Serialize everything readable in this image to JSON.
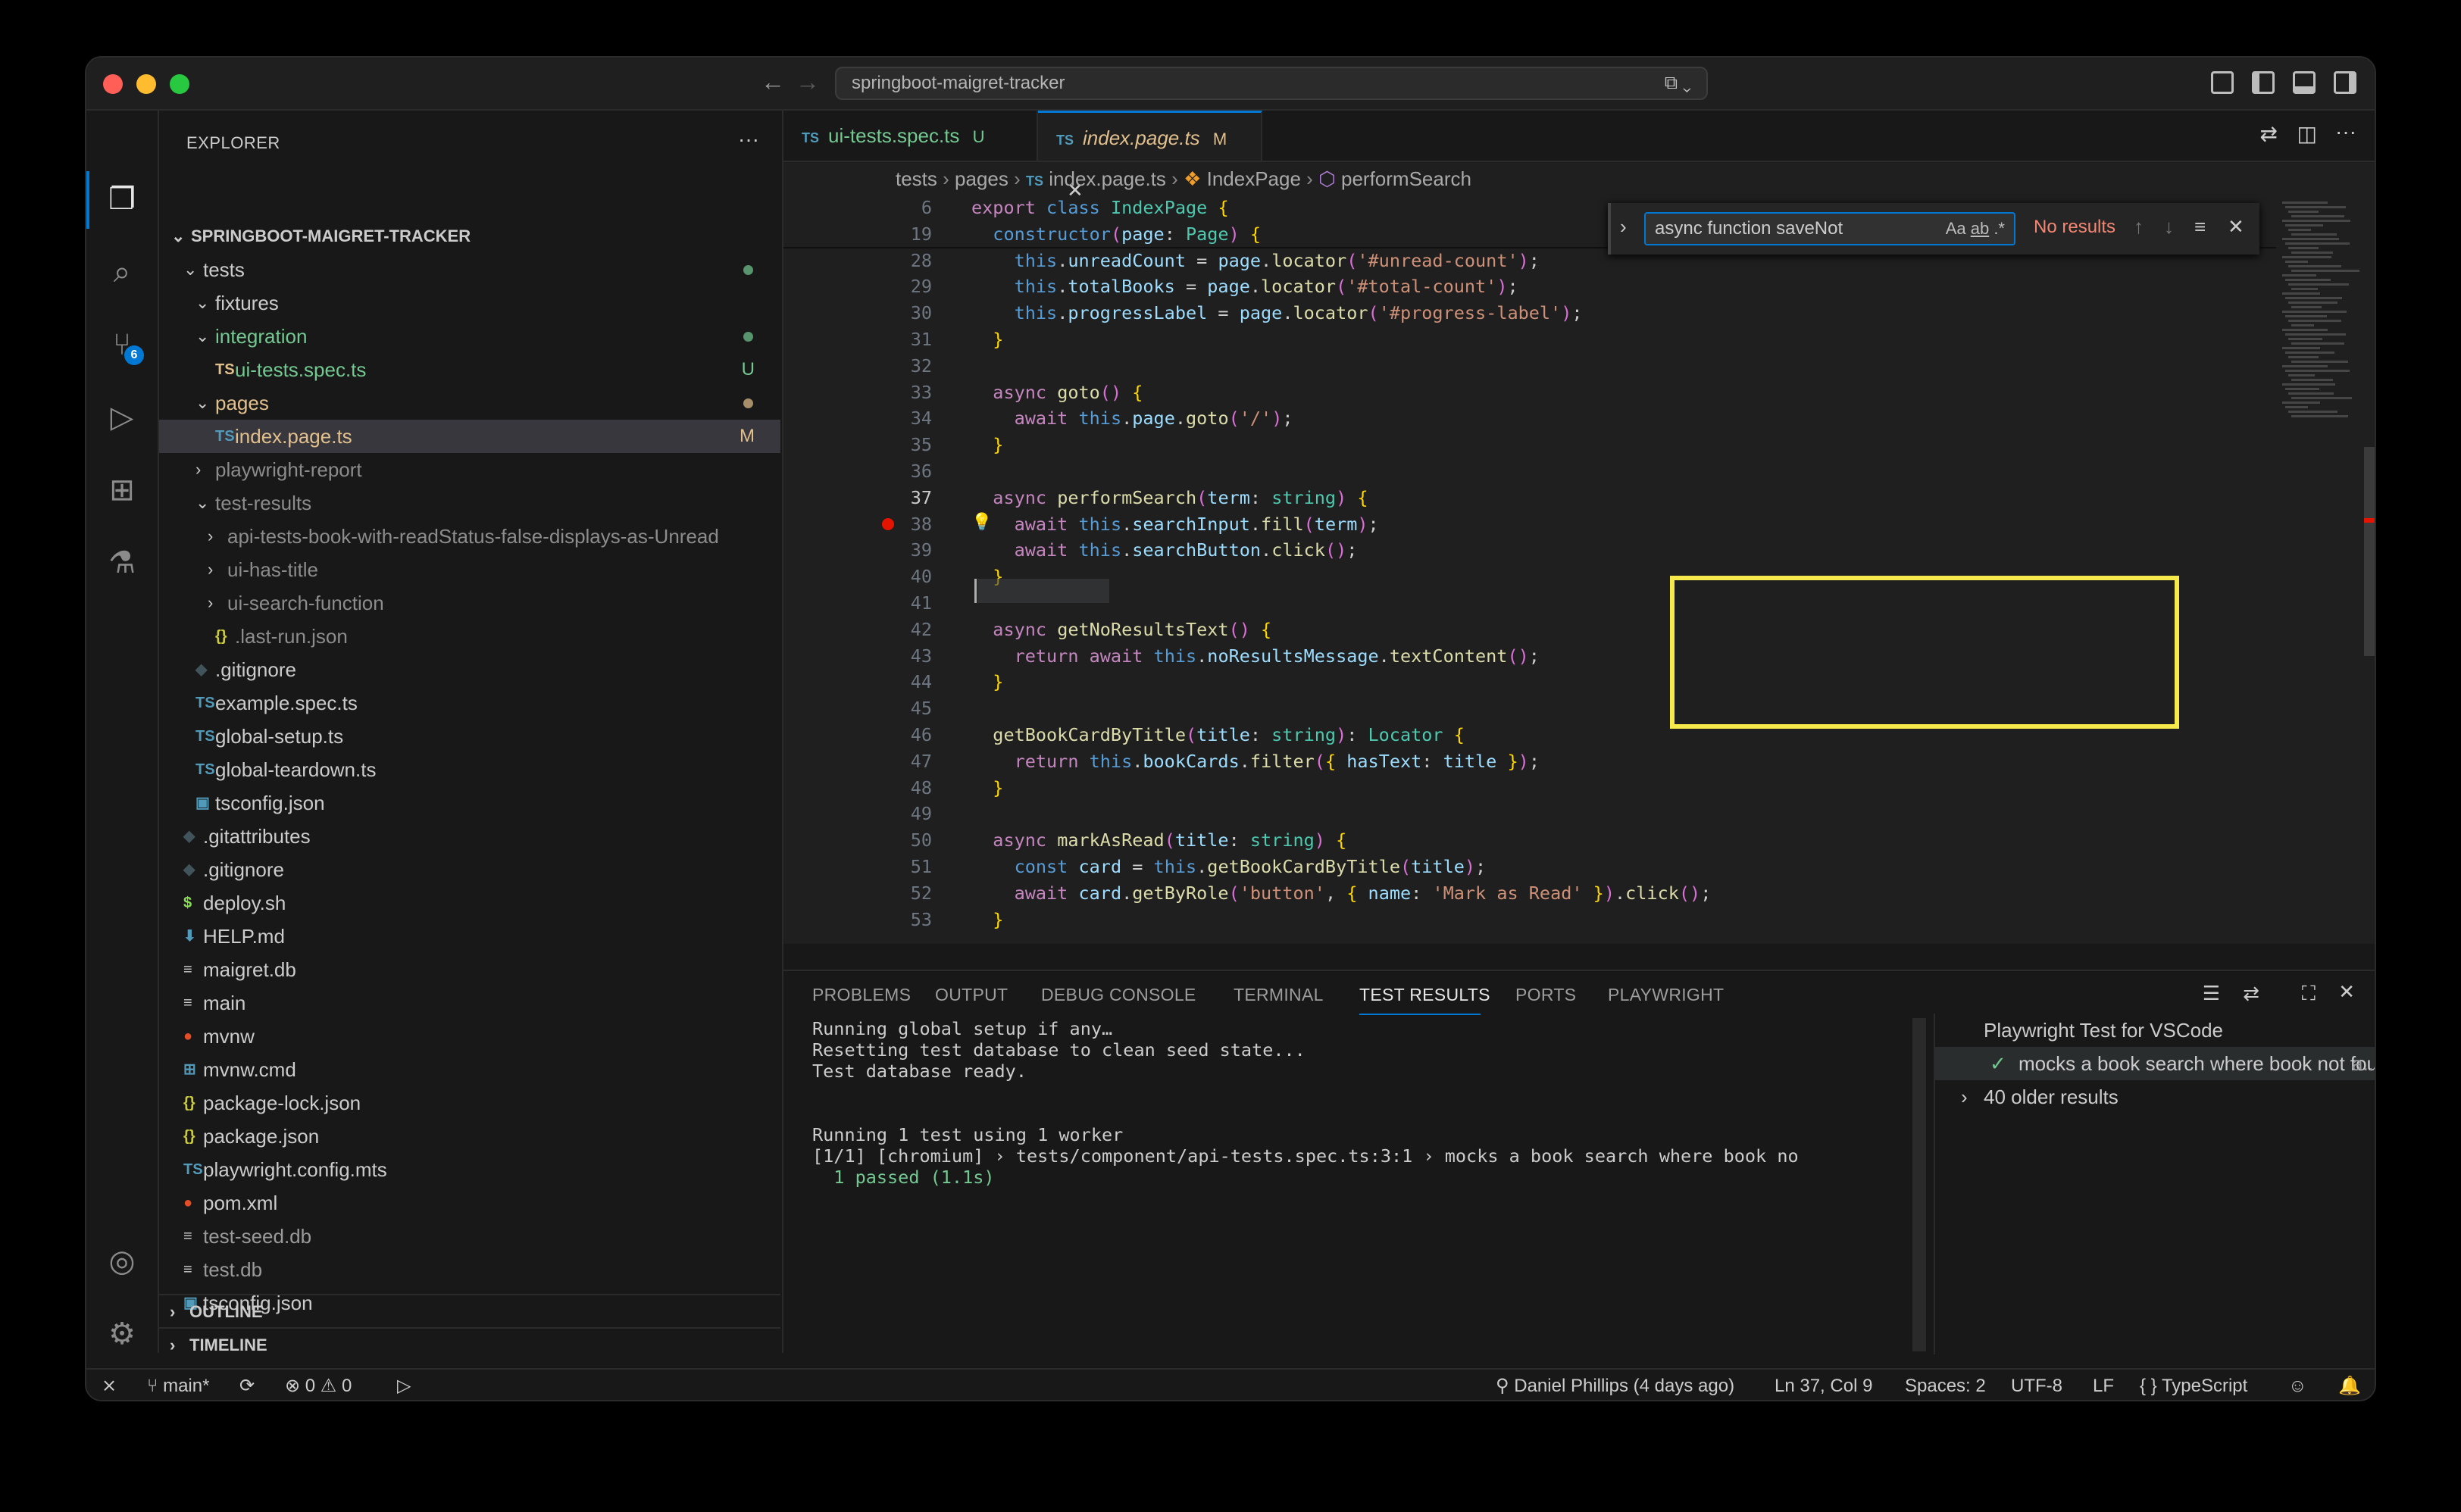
{
  "window": {
    "command_center": "springboot-maigret-tracker",
    "colors": {
      "red": "#ff5f57",
      "yellow": "#febc2e",
      "green": "#28c840",
      "accent": "#0078d4"
    }
  },
  "activity": {
    "scm_badge": "6"
  },
  "sidebar": {
    "title": "EXPLORER",
    "root": "SPRINGBOOT-MAIGRET-TRACKER",
    "items": [
      {
        "label": "tests",
        "decoration": ""
      },
      {
        "label": "fixtures",
        "decoration": ""
      },
      {
        "label": "integration",
        "decoration": ""
      },
      {
        "label": "ui-tests.spec.ts",
        "decoration": "U"
      },
      {
        "label": "pages",
        "decoration": ""
      },
      {
        "label": "index.page.ts",
        "decoration": "M"
      },
      {
        "label": "playwright-report",
        "decoration": ""
      },
      {
        "label": "test-results",
        "decoration": ""
      },
      {
        "label": "api-tests-book-with-readStatus-false-displays-as-Unread",
        "decoration": ""
      },
      {
        "label": "ui-has-title",
        "decoration": ""
      },
      {
        "label": "ui-search-function",
        "decoration": ""
      },
      {
        "label": ".last-run.json",
        "decoration": ""
      },
      {
        "label": ".gitignore",
        "decoration": ""
      },
      {
        "label": "example.spec.ts",
        "decoration": ""
      },
      {
        "label": "global-setup.ts",
        "decoration": ""
      },
      {
        "label": "global-teardown.ts",
        "decoration": ""
      },
      {
        "label": "tsconfig.json",
        "decoration": ""
      },
      {
        "label": ".gitattributes",
        "decoration": ""
      },
      {
        "label": ".gitignore",
        "decoration": ""
      },
      {
        "label": "deploy.sh",
        "decoration": ""
      },
      {
        "label": "HELP.md",
        "decoration": ""
      },
      {
        "label": "maigret.db",
        "decoration": ""
      },
      {
        "label": "main",
        "decoration": ""
      },
      {
        "label": "mvnw",
        "decoration": ""
      },
      {
        "label": "mvnw.cmd",
        "decoration": ""
      },
      {
        "label": "package-lock.json",
        "decoration": ""
      },
      {
        "label": "package.json",
        "decoration": ""
      },
      {
        "label": "playwright.config.mts",
        "decoration": ""
      },
      {
        "label": "pom.xml",
        "decoration": ""
      },
      {
        "label": "test-seed.db",
        "decoration": ""
      },
      {
        "label": "test.db",
        "decoration": ""
      },
      {
        "label": "tsconfig.json",
        "decoration": ""
      }
    ],
    "outline": "OUTLINE",
    "timeline": "TIMELINE"
  },
  "editor": {
    "tabs": [
      {
        "label": "ui-tests.spec.ts",
        "status": "U"
      },
      {
        "label": "index.page.ts",
        "status": "M"
      }
    ],
    "breadcrumb": [
      "tests",
      "pages",
      "index.page.ts",
      "IndexPage",
      "performSearch"
    ],
    "find": {
      "query": "async function saveNot",
      "result": "No results"
    },
    "lines": [
      {
        "n": "6",
        "code": "export class IndexPage {"
      },
      {
        "n": "19",
        "code": "  constructor(page: Page) {"
      },
      {
        "n": "28",
        "code": "    this.unreadCount = page.locator('#unread-count');"
      },
      {
        "n": "29",
        "code": "    this.totalBooks = page.locator('#total-count');"
      },
      {
        "n": "30",
        "code": "    this.progressLabel = page.locator('#progress-label');"
      },
      {
        "n": "31",
        "code": "  }"
      },
      {
        "n": "32",
        "code": ""
      },
      {
        "n": "33",
        "code": "  async goto() {"
      },
      {
        "n": "34",
        "code": "    await this.page.goto('/');"
      },
      {
        "n": "35",
        "code": "  }"
      },
      {
        "n": "36",
        "code": ""
      },
      {
        "n": "37",
        "code": "  async performSearch(term: string) {"
      },
      {
        "n": "38",
        "code": "    await this.searchInput.fill(term);"
      },
      {
        "n": "39",
        "code": "    await this.searchButton.click();"
      },
      {
        "n": "40",
        "code": "  }"
      },
      {
        "n": "41",
        "code": ""
      },
      {
        "n": "42",
        "code": "  async getNoResultsText() {"
      },
      {
        "n": "43",
        "code": "    return await this.noResultsMessage.textContent();"
      },
      {
        "n": "44",
        "code": "  }"
      },
      {
        "n": "45",
        "code": ""
      },
      {
        "n": "46",
        "code": "  getBookCardByTitle(title: string): Locator {"
      },
      {
        "n": "47",
        "code": "    return this.bookCards.filter({ hasText: title });"
      },
      {
        "n": "48",
        "code": "  }"
      },
      {
        "n": "49",
        "code": ""
      },
      {
        "n": "50",
        "code": "  async markAsRead(title: string) {"
      },
      {
        "n": "51",
        "code": "    const card = this.getBookCardByTitle(title);"
      },
      {
        "n": "52",
        "code": "    await card.getByRole('button', { name: 'Mark as Read' }).click();"
      },
      {
        "n": "53",
        "code": "  }"
      }
    ]
  },
  "panel": {
    "tabs": [
      "PROBLEMS",
      "OUTPUT",
      "DEBUG CONSOLE",
      "TERMINAL",
      "TEST RESULTS",
      "PORTS",
      "PLAYWRIGHT"
    ],
    "output": [
      "Running global setup if any…",
      "Resetting test database to clean seed state...",
      "Test database ready.",
      "",
      "Running 1 test using 1 worker",
      "[1/1] [chromium] › tests/component/api-tests.spec.ts:3:1 › mocks a book search where book no",
      "  1 passed (1.1s)"
    ],
    "results": {
      "header": "Playwright Test for VSCode",
      "passed_test": "mocks a book search where book not found",
      "passed_suffix": "a...",
      "older": "40 older results"
    }
  },
  "status": {
    "branch": "main*",
    "errors": "0",
    "warnings": "0",
    "blame": "Daniel Phillips (4 days ago)",
    "position": "Ln 37, Col 9",
    "spaces": "Spaces: 2",
    "encoding": "UTF-8",
    "eol": "LF",
    "language": "TypeScript"
  }
}
